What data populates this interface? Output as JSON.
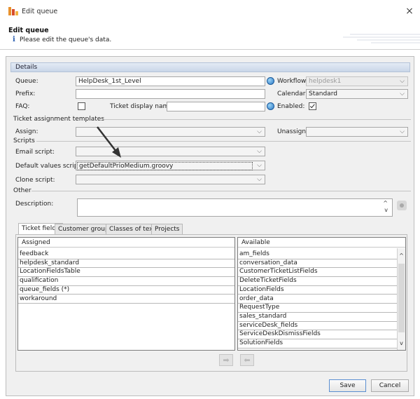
{
  "window": {
    "title": "Edit queue"
  },
  "header": {
    "bold_title": "Edit queue",
    "subtitle": "Please edit the queue's data."
  },
  "details": {
    "section_label": "Details",
    "queue_label": "Queue:",
    "queue_value": "HelpDesk_1st_Level",
    "workflow_label": "Workflow:",
    "workflow_value": "helpdesk1",
    "prefix_label": "Prefix:",
    "calendar_label": "Calendar:",
    "calendar_value": "Standard",
    "faq_label": "FAQ:",
    "ticket_display_label": "Ticket display name:",
    "enabled_label": "Enabled:"
  },
  "assignment": {
    "group_label": "Ticket assignment templates",
    "assign_label": "Assign:",
    "unassign_label": "Unassign:"
  },
  "scripts": {
    "group_label": "Scripts",
    "email_label": "Email script:",
    "default_values_label": "Default values script:",
    "default_values_value": "getDefaultPrioMedium.groovy",
    "clone_label": "Clone script:"
  },
  "other": {
    "group_label": "Other",
    "description_label": "Description:"
  },
  "tabs": [
    {
      "label": "Ticket fields"
    },
    {
      "label": "Customer groups"
    },
    {
      "label": "Classes of text"
    },
    {
      "label": "Projects"
    }
  ],
  "assigned": {
    "header": "Assigned",
    "items": [
      "feedback",
      "helpdesk_standard",
      "LocationFieldsTable",
      "qualification",
      "queue_fields (*)",
      "workaround"
    ]
  },
  "available": {
    "header": "Available",
    "items": [
      "am_fields",
      "conversation_data",
      "CustomerTicketListFields",
      "DeleteTicketFields",
      "LocationFields",
      "order_data",
      "RequestType",
      "sales_standard",
      "serviceDesk_fields",
      "ServiceDeskDismissFields",
      "SolutionFields"
    ]
  },
  "buttons": {
    "save": "Save",
    "cancel": "Cancel"
  },
  "icons": {
    "info": "i",
    "close": "×",
    "dropdown": "⌵",
    "move_right": "➡",
    "move_left": "⬅"
  }
}
